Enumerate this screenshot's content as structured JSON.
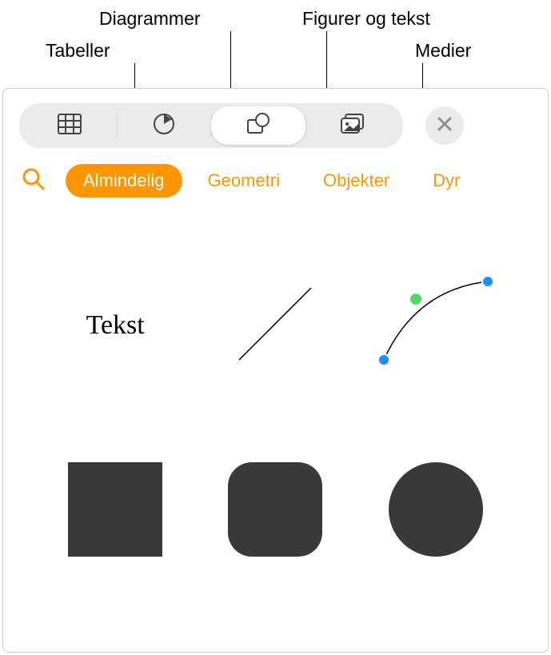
{
  "callouts": {
    "tables": "Tabeller",
    "charts": "Diagrammer",
    "shapes_text": "Figurer og tekst",
    "media": "Medier"
  },
  "tabs": {
    "basic": "Almindelig",
    "geometry": "Geometri",
    "objects": "Objekter",
    "animals": "Dyr"
  },
  "shapes": {
    "text_label": "Tekst"
  },
  "colors": {
    "accent": "#ff9500",
    "shape_fill": "#3a3838",
    "point_blue": "#1e90ff",
    "point_green": "#4cd964"
  }
}
